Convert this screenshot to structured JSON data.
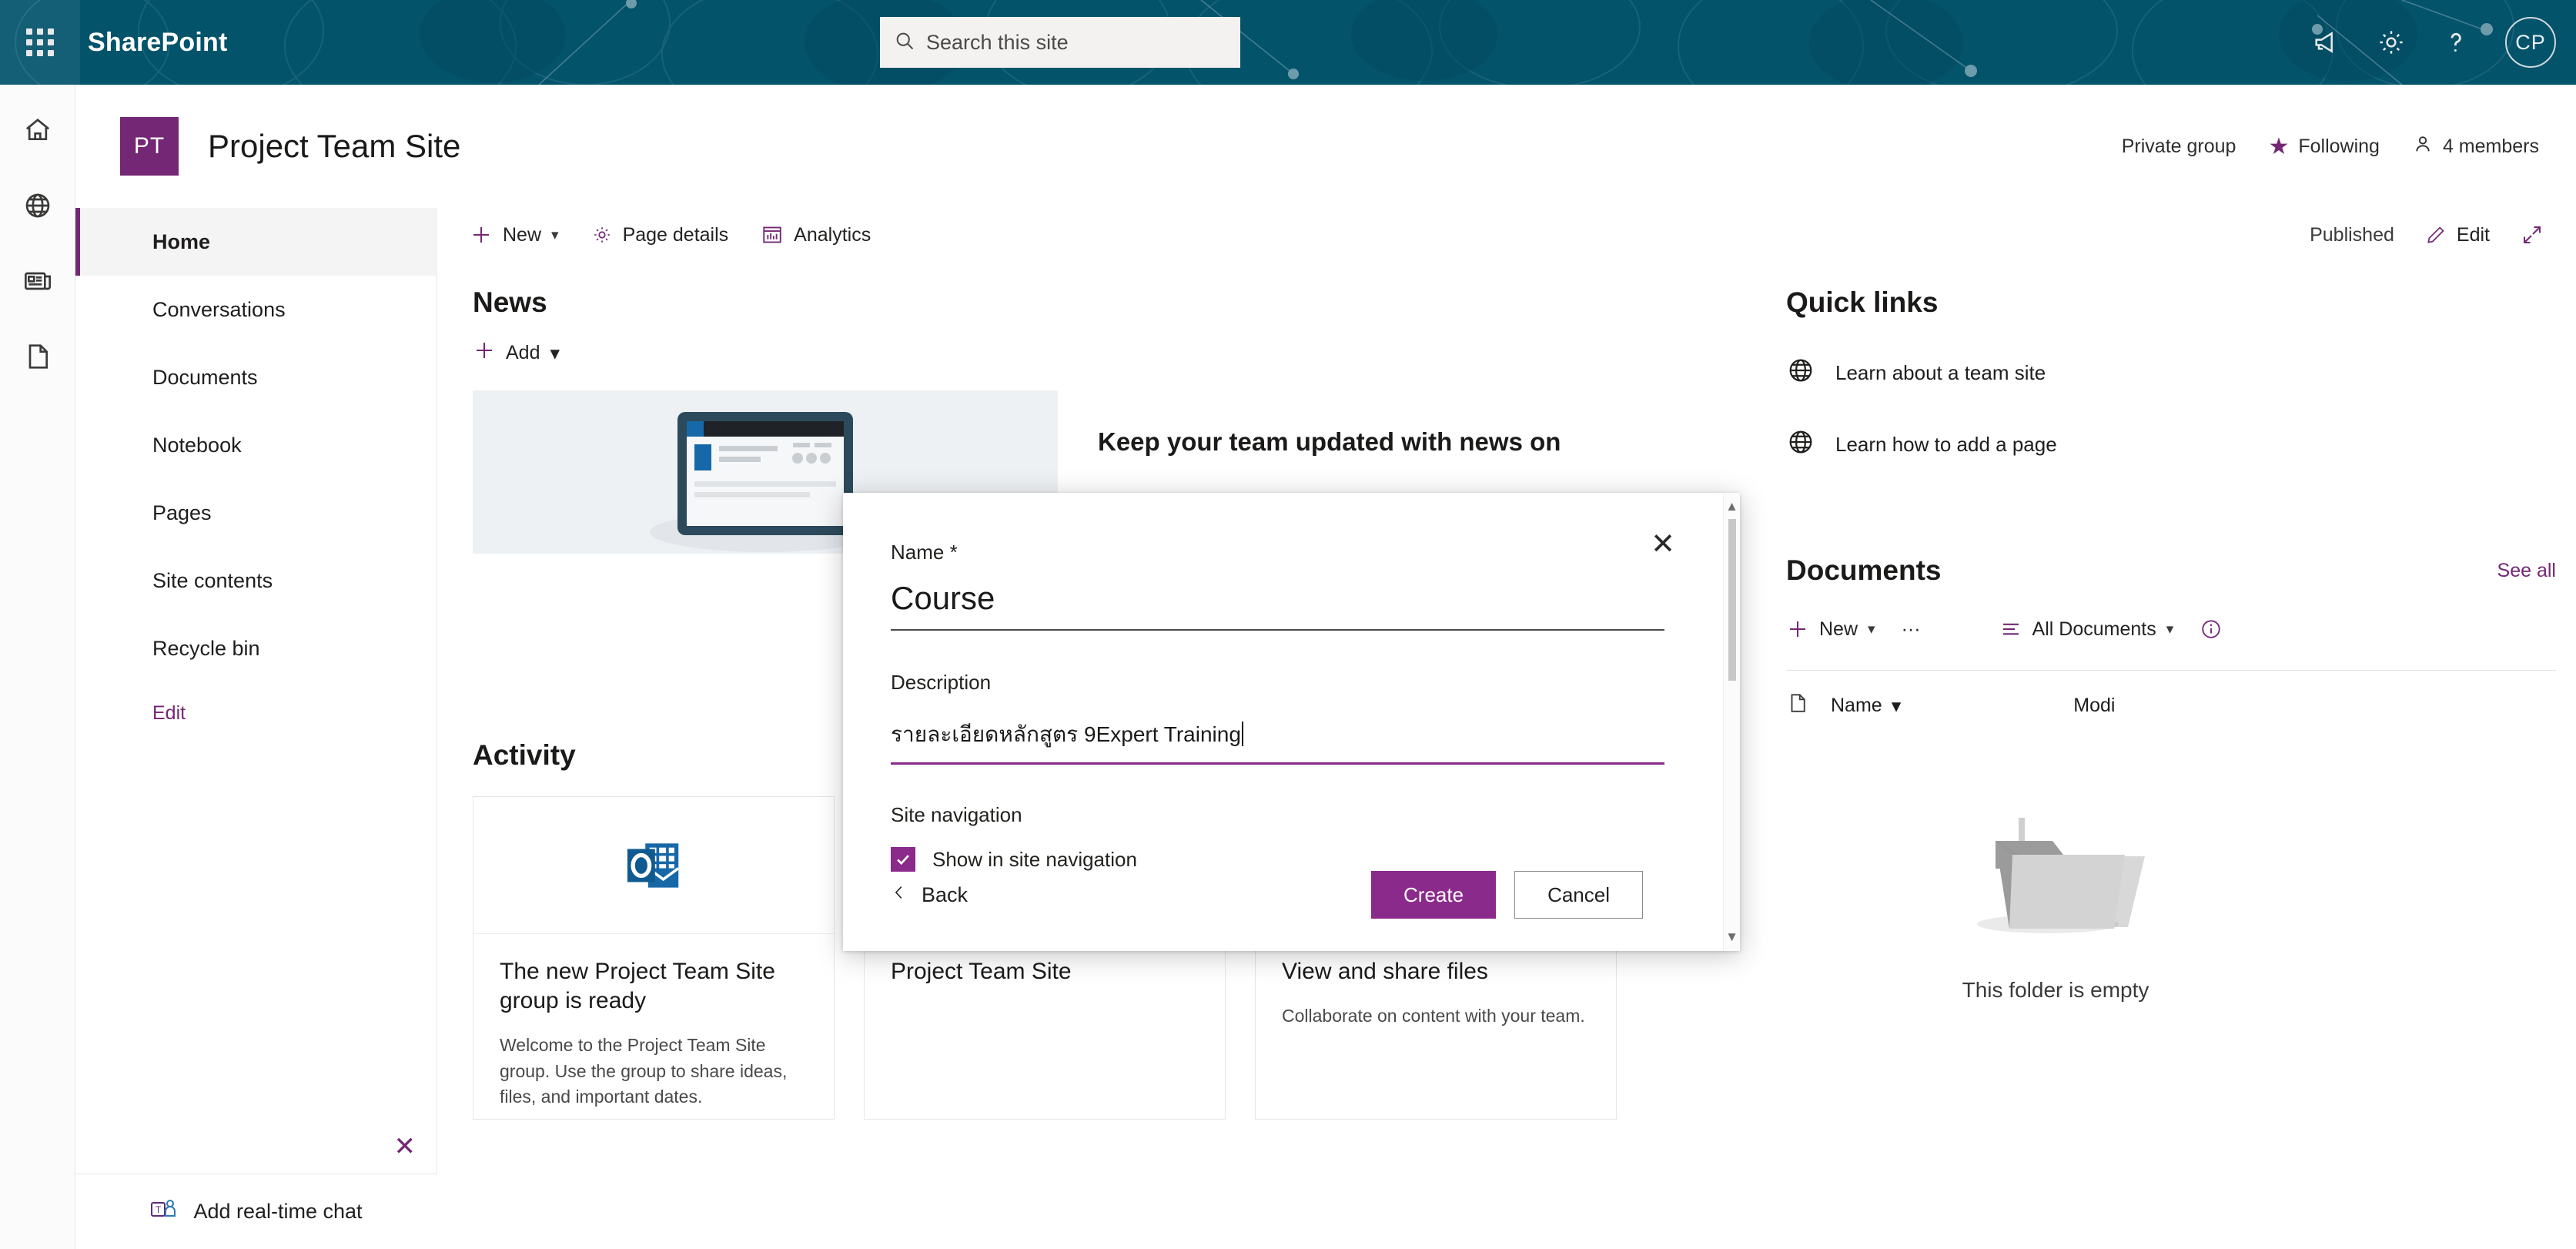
{
  "suite": {
    "brand": "SharePoint",
    "waffle_icon": "app-launcher-icon",
    "search": {
      "placeholder": "Search this site",
      "icon": "search-icon"
    },
    "icons": [
      {
        "name": "megaphone-icon"
      },
      {
        "name": "gear-icon"
      },
      {
        "name": "help-icon"
      }
    ],
    "avatar_initials": "CP",
    "bg_color": "#03536b"
  },
  "rail": {
    "items": [
      {
        "name": "home-icon"
      },
      {
        "name": "globe-icon"
      },
      {
        "name": "news-icon"
      },
      {
        "name": "document-icon"
      }
    ]
  },
  "site_header": {
    "logo_initials": "PT",
    "logo_color": "#742774",
    "title": "Project Team Site",
    "privacy": "Private group",
    "following": "Following",
    "members": "4 members"
  },
  "leftnav": {
    "items": [
      {
        "label": "Home",
        "active": true
      },
      {
        "label": "Conversations",
        "active": false
      },
      {
        "label": "Documents",
        "active": false
      },
      {
        "label": "Notebook",
        "active": false
      },
      {
        "label": "Pages",
        "active": false
      },
      {
        "label": "Site contents",
        "active": false
      },
      {
        "label": "Recycle bin",
        "active": false
      }
    ],
    "edit_label": "Edit"
  },
  "commandbar": {
    "new_label": "New",
    "page_details_label": "Page details",
    "analytics_label": "Analytics",
    "published_label": "Published",
    "edit_label": "Edit",
    "expand_icon": "expand-icon"
  },
  "news": {
    "title": "News",
    "add_label": "Add",
    "headline": "Keep your team updated with news on"
  },
  "quick_links": {
    "title": "Quick links",
    "items": [
      {
        "label": "Learn about a team site",
        "icon": "globe-icon"
      },
      {
        "label": "Learn how to add a page",
        "icon": "globe-icon"
      }
    ]
  },
  "documents": {
    "title": "Documents",
    "see_all": "See all",
    "new_label": "New",
    "more_label": "···",
    "view_label": "All Documents",
    "info_icon": "info-icon",
    "columns": [
      "Name",
      "Modi"
    ],
    "empty_label": "This folder is empty"
  },
  "activity": {
    "title": "Activity",
    "cards": [
      {
        "icon": "outlook-icon",
        "title": "The new Project Team Site group is ready",
        "desc": "Welcome to the Project Team Site group. Use the group to share ideas, files, and important dates."
      },
      {
        "icon": "site-tile-icon",
        "title": "Project Team Site",
        "desc": ""
      },
      {
        "icon": "folder-icon",
        "title": "View and share files",
        "desc": "Collaborate on content with your team."
      }
    ]
  },
  "chatbar": {
    "label": "Add real-time chat",
    "icon": "teams-icon",
    "close_icon": "close-icon"
  },
  "dialog": {
    "close_icon": "close-icon",
    "name_label": "Name *",
    "name_value": "Course",
    "description_label": "Description",
    "description_value": "รายละเอียดหลักสูตร 9Expert Training",
    "site_nav_label": "Site navigation",
    "checkbox_label": "Show in site navigation",
    "checkbox_checked": true,
    "back_label": "Back",
    "create_label": "Create",
    "cancel_label": "Cancel",
    "accent_color": "#8a2a8a"
  }
}
